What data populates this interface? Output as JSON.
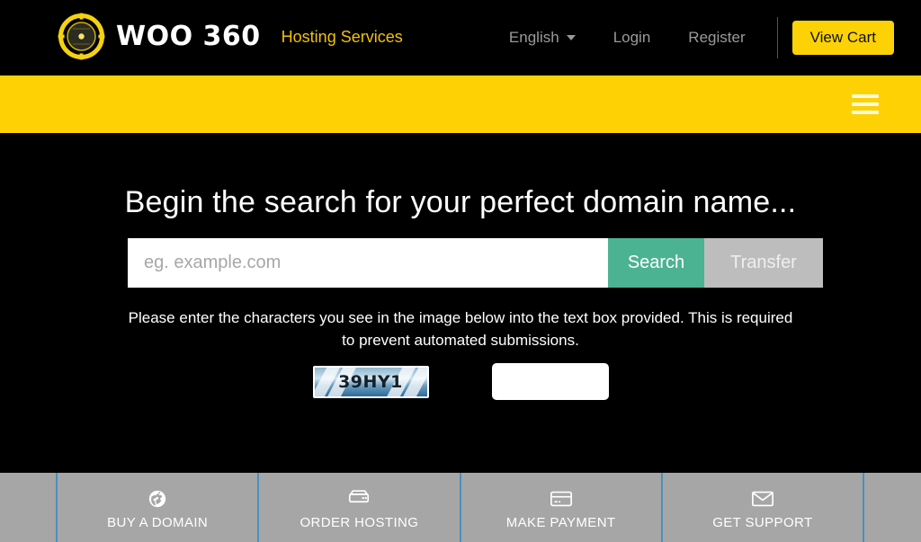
{
  "header": {
    "logo_icon": "woo360-circular-emblem",
    "brand_name": "WOO 360",
    "tagline": "Hosting Services",
    "nav": [
      {
        "label": "English",
        "icon": "chevron-down-icon",
        "has_caret": true
      },
      {
        "label": "Login",
        "has_caret": false
      },
      {
        "label": "Register",
        "has_caret": false
      }
    ],
    "cart_button": "View Cart",
    "cart_button_color": "#fcd207"
  },
  "menubar": {
    "background_color": "#fdd104",
    "menu_icon": "hamburger-menu-icon"
  },
  "hero": {
    "title": "Begin the search for your perfect domain name...",
    "search": {
      "placeholder": "eg. example.com",
      "value": "",
      "search_label": "Search",
      "transfer_label": "Transfer",
      "search_color": "#4bb391",
      "transfer_color": "#bdbdbd"
    },
    "captcha": {
      "instructions": "Please enter the characters you see in the image below into the text box provided. This is required to prevent automated submissions.",
      "image_text": "39HY1",
      "input_value": "",
      "input_placeholder": ""
    }
  },
  "quickbar": {
    "background_color": "#a6a6a6",
    "divider_color": "#4d8fbb",
    "items": [
      {
        "label": "BUY A DOMAIN",
        "icon": "globe-icon"
      },
      {
        "label": "ORDER HOSTING",
        "icon": "server-icon"
      },
      {
        "label": "MAKE PAYMENT",
        "icon": "credit-card-icon"
      },
      {
        "label": "GET SUPPORT",
        "icon": "envelope-icon"
      }
    ]
  }
}
